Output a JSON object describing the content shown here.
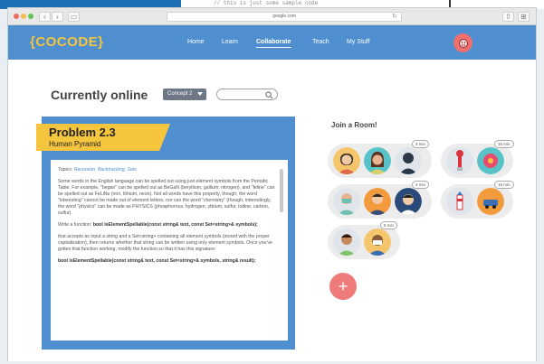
{
  "colors": {
    "nav": "#4f8fcf",
    "logo": "#f5c53d",
    "banner": "#f5c53d",
    "accent": "#ef6f6f"
  },
  "editor_snippet": "// this is just some sample code",
  "browser": {
    "url": "google.com",
    "back_icon": "chevron-left-icon",
    "forward_icon": "chevron-right-icon",
    "sidebar_icon": "sidebar-icon",
    "reload_icon": "reload-icon",
    "share_icon": "share-icon",
    "tabs_icon": "tabs-icon"
  },
  "nav": {
    "logo": "{COCODE}",
    "links": [
      "Home",
      "Learn",
      "Collaborate",
      "Teach",
      "My Stuff"
    ],
    "active": "Collaborate"
  },
  "main": {
    "heading": "Currently online",
    "concept_select": "Concept 2",
    "search_placeholder": ""
  },
  "problem": {
    "title": "Problem 2.3",
    "subtitle": "Human Pyramid",
    "topics_label": "Topics:",
    "topics": "Recursion, Backtracking, Sets",
    "para1": "Some words in the English language can be spelled out using just element symbols from the Periodic Table. For example, \"began\" can be spelled out as BeGaN (beryllium, gallium, nitrogen), and \"feline\" can be spelled out as FeLiNe (iron, lithium, neon). Not all words have this property, though; the word \"interesting\" cannot be made out of element letters, nor can the word \"chemistry\" (though, interestingly, the word \"physics\" can be made as PHYSICS (phosphorous, hydrogen, yttrium, sulfur, iodine, carbon, sulfur).",
    "para2_prefix": "Write a function:",
    "para2_code": "bool isElementSpellable(const string& text, const Set<string>& symbols);",
    "para3": "that accepts as input a string and a Set<string> containing all element symbols (stored with the proper capitalization), then returns whether that string can be written using only element symbols. Once you've gotten that function working, modify the function so that it has this signature:",
    "para4_code": "bool isElementSpellable(const string& text, const Set<string>& symbols, string& result);"
  },
  "rooms": {
    "heading": "Join a Room!",
    "badges": [
      "4 min",
      "15 min",
      "4 min",
      "15 min",
      "8 min"
    ],
    "add_label": "+"
  }
}
